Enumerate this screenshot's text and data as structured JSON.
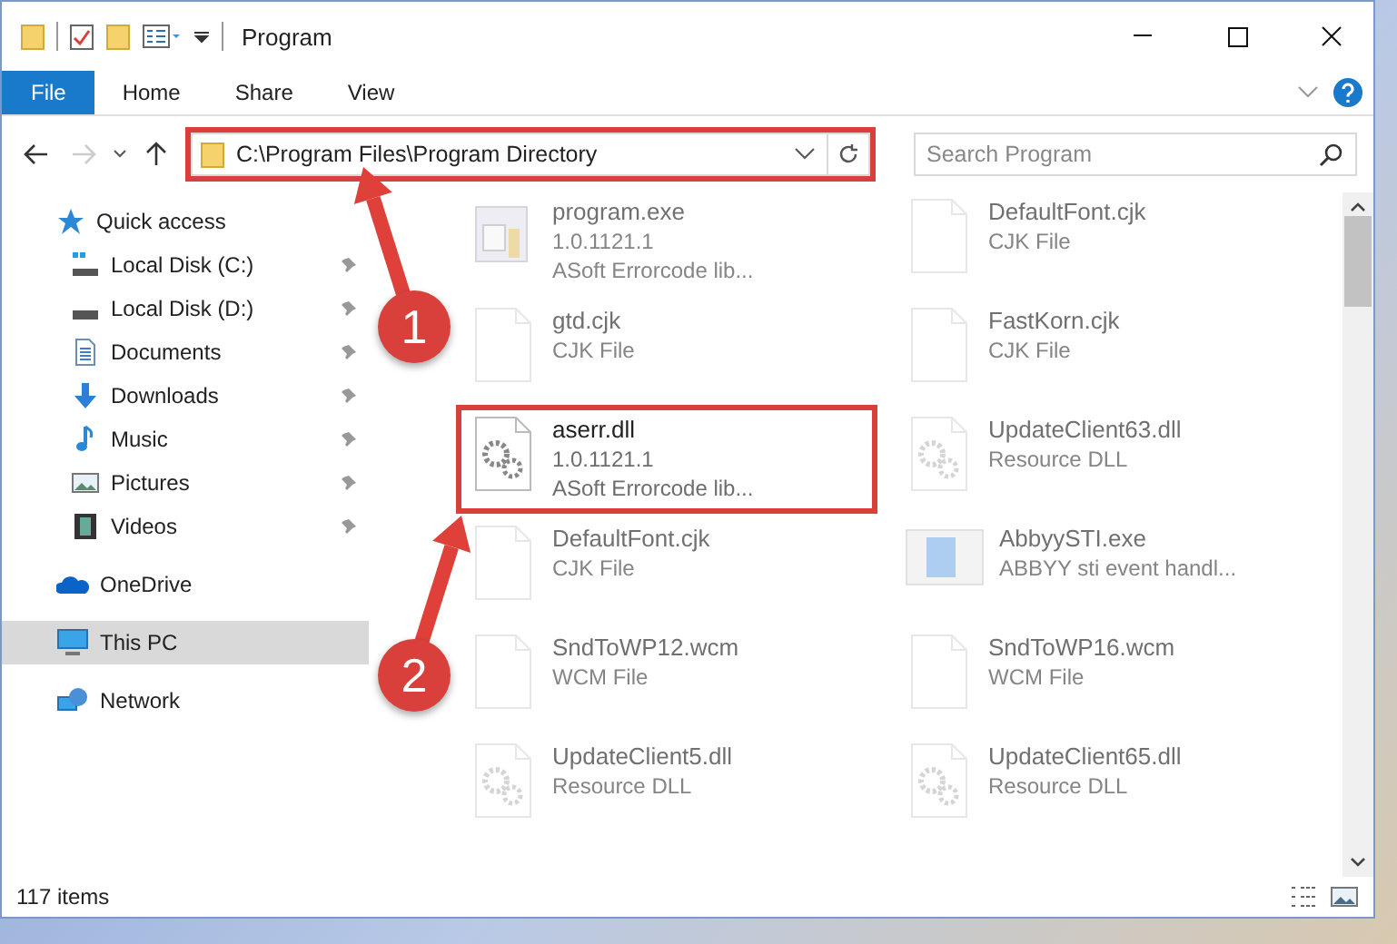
{
  "window": {
    "title": "Program"
  },
  "ribbon_tabs": [
    {
      "label": "File",
      "selected": true
    },
    {
      "label": "Home",
      "selected": false
    },
    {
      "label": "Share",
      "selected": false
    },
    {
      "label": "View",
      "selected": false
    }
  ],
  "address_bar": {
    "path": "C:\\Program Files\\Program Directory",
    "highlighted": true
  },
  "search": {
    "placeholder": "Search Program"
  },
  "navigation": {
    "forward_disabled": true
  },
  "sidebar": {
    "items": [
      {
        "label": "Quick access",
        "kind": "star",
        "selected": false,
        "children": [
          {
            "label": "Local Disk (C:)",
            "kind": "sysdisk",
            "pinned": true,
            "selected": false
          },
          {
            "label": "Local Disk (D:)",
            "kind": "disk",
            "pinned": true,
            "selected": false
          },
          {
            "label": "Documents",
            "kind": "documents",
            "pinned": true,
            "selected": false
          },
          {
            "label": "Downloads",
            "kind": "downloads",
            "pinned": true,
            "selected": false
          },
          {
            "label": "Music",
            "kind": "music",
            "pinned": true,
            "selected": false
          },
          {
            "label": "Pictures",
            "kind": "pictures",
            "pinned": true,
            "selected": false
          },
          {
            "label": "Videos",
            "kind": "videos",
            "pinned": true,
            "selected": false
          }
        ]
      },
      {
        "label": "OneDrive",
        "kind": "cloud",
        "selected": false
      },
      {
        "label": "This PC",
        "kind": "pc",
        "selected": true
      },
      {
        "label": "Network",
        "kind": "network",
        "selected": false
      }
    ]
  },
  "files": [
    {
      "name": "program.exe",
      "lines": [
        "1.0.1121.1",
        "ASoft Errorcode lib..."
      ],
      "kind": "app",
      "dimmed": true,
      "highlighted": false
    },
    {
      "name": "DefaultFont.cjk",
      "lines": [
        "CJK File"
      ],
      "kind": "blank",
      "dimmed": true,
      "highlighted": false
    },
    {
      "name": "gtd.cjk",
      "lines": [
        "CJK File"
      ],
      "kind": "blank",
      "dimmed": true,
      "highlighted": false
    },
    {
      "name": "FastKorn.cjk",
      "lines": [
        "CJK File"
      ],
      "kind": "blank",
      "dimmed": true,
      "highlighted": false
    },
    {
      "name": "aserr.dll",
      "lines": [
        "1.0.1121.1",
        "ASoft Errorcode lib..."
      ],
      "kind": "dll",
      "dimmed": false,
      "highlighted": true
    },
    {
      "name": "UpdateClient63.dll",
      "lines": [
        "Resource DLL"
      ],
      "kind": "dll",
      "dimmed": true,
      "highlighted": false
    },
    {
      "name": "DefaultFont.cjk",
      "lines": [
        "CJK File"
      ],
      "kind": "blank",
      "dimmed": true,
      "highlighted": false
    },
    {
      "name": "AbbyySTI.exe",
      "lines": [
        "ABBYY sti event handl..."
      ],
      "kind": "window",
      "dimmed": true,
      "highlighted": false
    },
    {
      "name": "SndToWP12.wcm",
      "lines": [
        "WCM File"
      ],
      "kind": "blank",
      "dimmed": true,
      "highlighted": false
    },
    {
      "name": "SndToWP16.wcm",
      "lines": [
        "WCM File"
      ],
      "kind": "blank",
      "dimmed": true,
      "highlighted": false
    },
    {
      "name": "UpdateClient5.dll",
      "lines": [
        "Resource DLL"
      ],
      "kind": "dll",
      "dimmed": true,
      "highlighted": false
    },
    {
      "name": "UpdateClient65.dll",
      "lines": [
        "Resource DLL"
      ],
      "kind": "dll",
      "dimmed": true,
      "highlighted": false
    }
  ],
  "status_bar": {
    "count": "117 items"
  },
  "annotations": [
    {
      "number": "1"
    },
    {
      "number": "2"
    }
  ]
}
